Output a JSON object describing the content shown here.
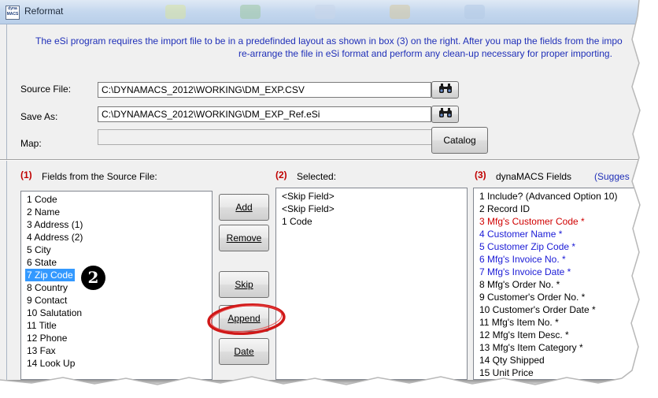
{
  "window": {
    "title": "Reformat",
    "app_icon_text": "dyna MACS"
  },
  "info": {
    "line1": "The eSi program requires the import file to be in a predefinded layout as shown in box (3) on the right. After you map the fields from the impo",
    "line2": "re-arrange the file in eSi format and perform any clean-up necessary for proper importing."
  },
  "source_file": {
    "label": "Source File:",
    "value": "C:\\DYNAMACS_2012\\WORKING\\DM_EXP.CSV"
  },
  "save_as": {
    "label": "Save As:",
    "value": "C:\\DYNAMACS_2012\\WORKING\\DM_EXP_Ref.eSi"
  },
  "map": {
    "label": "Map:",
    "value": ""
  },
  "buttons": {
    "catalog": "Catalog",
    "add": "Add",
    "remove": "Remove",
    "skip": "Skip",
    "append": "Append",
    "date": "Date"
  },
  "section1": {
    "num": "(1)",
    "title": "Fields from the Source File:",
    "items": [
      "1 Code",
      "2 Name",
      "3 Address (1)",
      "4 Address (2)",
      "5 City",
      "6 State",
      "7 Zip Code",
      "8 Country",
      "9 Contact",
      "10 Salutation",
      "11 Title",
      "12 Phone",
      "13 Fax",
      "14 Look Up"
    ],
    "selected_index": 6
  },
  "section2": {
    "num": "(2)",
    "title": "Selected:",
    "items": [
      "<Skip Field>",
      "<Skip Field>",
      "1 Code"
    ]
  },
  "section3": {
    "num": "(3)",
    "title": "dynaMACS Fields",
    "suggest": "(Sugges",
    "items": [
      {
        "text": "1 Include? (Advanced Option 10)",
        "color": "#000000"
      },
      {
        "text": "2 Record ID",
        "color": "#000000"
      },
      {
        "text": "3 Mfg's Customer Code *",
        "color": "#d00000"
      },
      {
        "text": "4 Customer Name *",
        "color": "#1a1ad6"
      },
      {
        "text": "5 Customer Zip Code *",
        "color": "#1a1ad6"
      },
      {
        "text": "6 Mfg's Invoice No. *",
        "color": "#1a1ad6"
      },
      {
        "text": "7 Mfg's Invoice Date *",
        "color": "#1a1ad6"
      },
      {
        "text": "8 Mfg's Order No. *",
        "color": "#000000"
      },
      {
        "text": "9 Customer's Order No. *",
        "color": "#000000"
      },
      {
        "text": "10 Customer's Order Date *",
        "color": "#000000"
      },
      {
        "text": "11 Mfg's Item No. *",
        "color": "#000000"
      },
      {
        "text": "12 Mfg's Item Desc. *",
        "color": "#000000"
      },
      {
        "text": "13 Mfg's Item Category *",
        "color": "#000000"
      },
      {
        "text": "14 Qty Shipped",
        "color": "#000000"
      },
      {
        "text": "15 Unit Price",
        "color": "#000000"
      }
    ]
  },
  "callout": {
    "number": "2"
  },
  "colors": {
    "info_text": "#1f2fb8",
    "section_num": "#c00000",
    "selection": "#3399ff",
    "annotation": "#d01818"
  }
}
